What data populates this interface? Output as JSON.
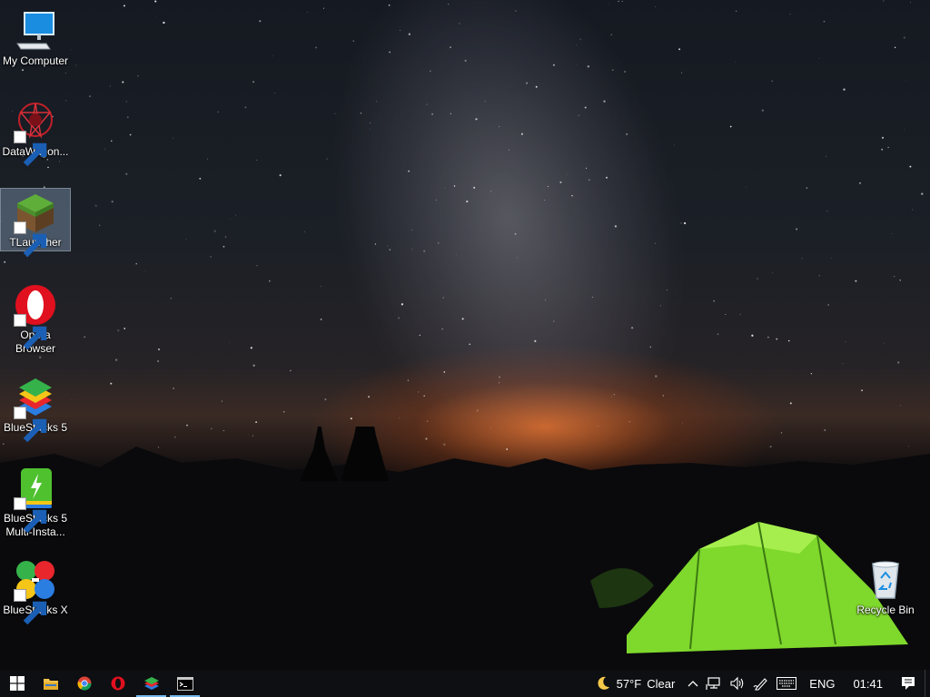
{
  "desktop": {
    "icons": [
      {
        "label": "My Computer",
        "icon": "computer-icon"
      },
      {
        "label": "DataWagon...",
        "icon": "datawagon-icon"
      },
      {
        "label": "TLauncher",
        "icon": "tlauncher-grass-block-icon"
      },
      {
        "label": "Opera Browser",
        "icon": "opera-icon"
      },
      {
        "label": "BlueStacks 5",
        "icon": "bluestacks-icon"
      },
      {
        "label": "BlueStacks 5 Multi-Insta...",
        "icon": "bluestacks-multi-instance-icon"
      },
      {
        "label": "BlueStacks X",
        "icon": "bluestacks-x-icon"
      },
      {
        "label": "Recycle Bin",
        "icon": "recycle-bin-icon"
      }
    ],
    "selected": "TLauncher"
  },
  "taskbar": {
    "pinned": [
      {
        "name": "start",
        "icon": "windows-logo-icon"
      },
      {
        "name": "file-explorer",
        "icon": "folder-icon"
      },
      {
        "name": "chrome",
        "icon": "chrome-icon"
      },
      {
        "name": "opera",
        "icon": "opera-icon"
      },
      {
        "name": "bluestacks",
        "icon": "bluestacks-icon"
      },
      {
        "name": "command-prompt",
        "icon": "cmd-icon"
      }
    ],
    "weather": {
      "icon": "moon-icon",
      "temp": "57°F",
      "condition": "Clear"
    },
    "tray": {
      "language": "ENG",
      "time": "01:41",
      "icons": [
        "chevron-up-icon",
        "network-icon",
        "volume-icon",
        "pen-icon",
        "keyboard-icon",
        "notification-icon"
      ]
    }
  },
  "colors": {
    "taskbar_bg": "#0d0f12",
    "running_indicator": "#76b9ed",
    "selection_bg": "#a0bedc"
  }
}
